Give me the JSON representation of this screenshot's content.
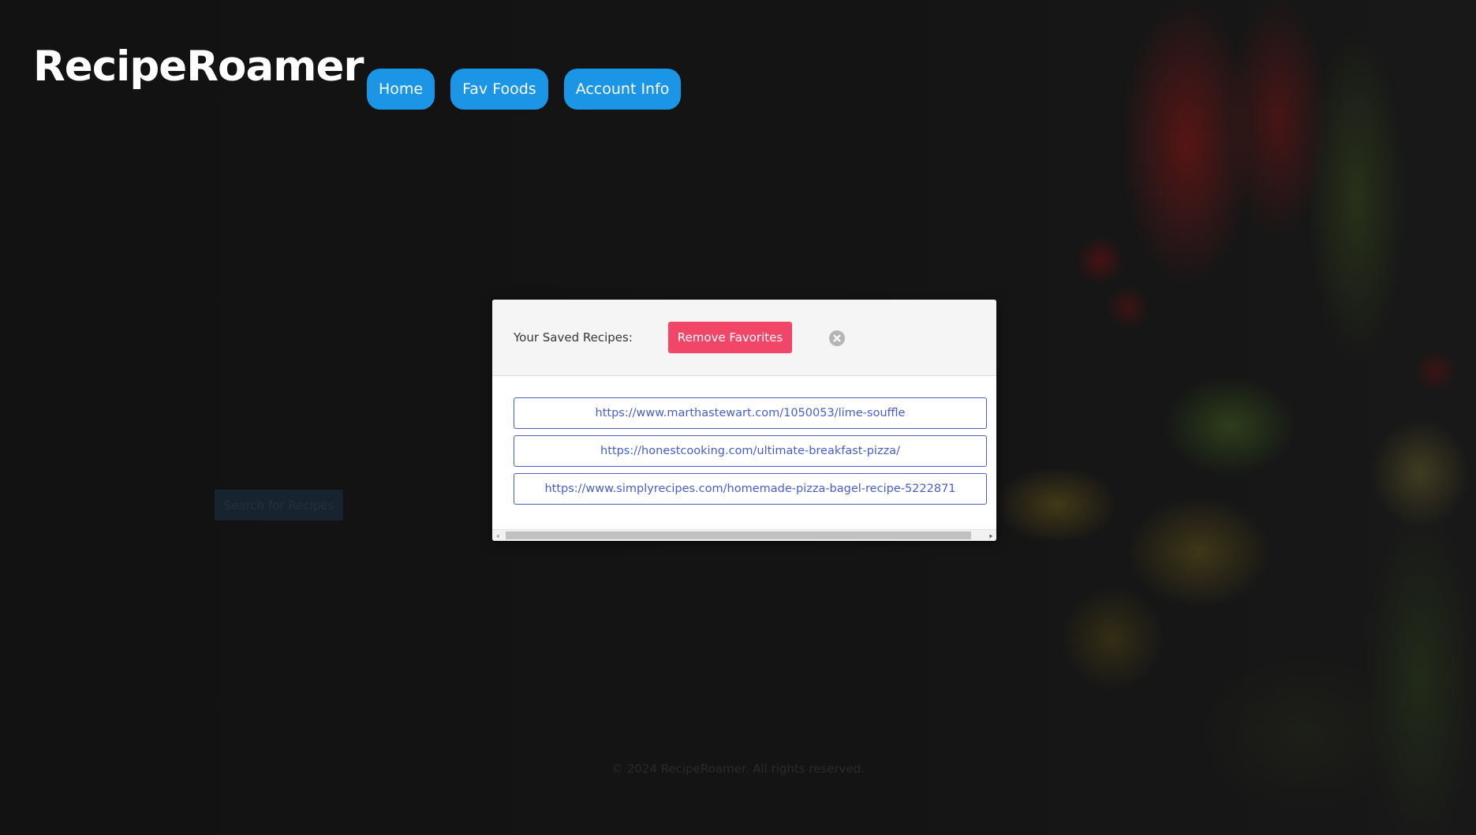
{
  "header": {
    "brand": "RecipeRoamer",
    "nav": [
      "Home",
      "Fav Foods",
      "Account Info"
    ]
  },
  "main": {
    "search_button": "Search for Recipes"
  },
  "footer": {
    "text": "© 2024 RecipeRoamer. All rights reserved."
  },
  "modal": {
    "title": "Your Saved Recipes:",
    "remove_button": "Remove Favorites",
    "close_icon": "close-circle-icon",
    "links": [
      "https://www.marthastewart.com/1050053/lime-souffle",
      "https://honestcooking.com/ultimate-breakfast-pizza/",
      "https://www.simplyrecipes.com/homemade-pizza-bagel-recipe-5222871"
    ]
  },
  "colors": {
    "nav_button": "#1b95e6",
    "remove_button": "#f14668",
    "link": "#485fc7",
    "background": "#131313"
  }
}
